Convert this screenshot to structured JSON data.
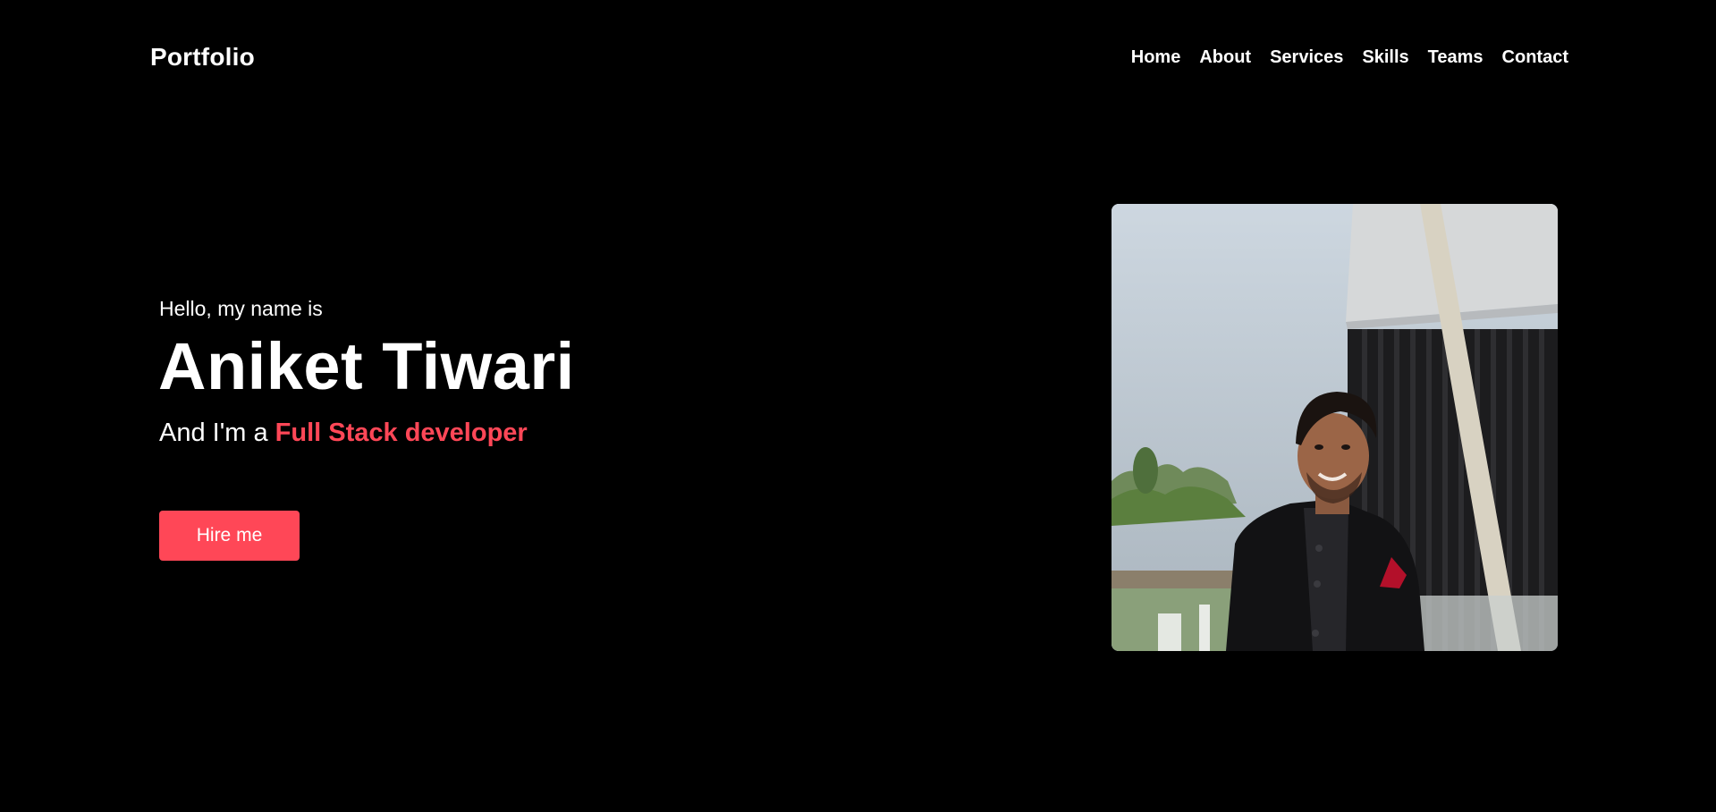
{
  "nav": {
    "logo": "Portfolio",
    "items": [
      {
        "label": "Home"
      },
      {
        "label": "About"
      },
      {
        "label": "Services"
      },
      {
        "label": "Skills"
      },
      {
        "label": "Teams"
      },
      {
        "label": "Contact"
      }
    ]
  },
  "hero": {
    "greeting": "Hello, my name is",
    "name": "Aniket Tiwari",
    "role_prefix": "And I'm a ",
    "role_highlight": "Full Stack developer",
    "cta_label": "Hire me"
  },
  "colors": {
    "background": "#000000",
    "text": "#ffffff",
    "accent": "#ff4757"
  },
  "profile_photo": {
    "alt": "profile-photo"
  }
}
